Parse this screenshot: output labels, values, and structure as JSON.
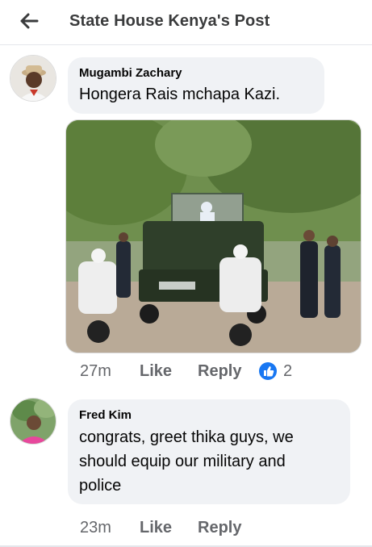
{
  "header": {
    "title": "State House Kenya's Post",
    "back_icon": "arrow-left-icon"
  },
  "comments": [
    {
      "author": "Mugambi Zachary",
      "text": "Hongera Rais mchapa Kazi.",
      "time": "27m",
      "like_label": "Like",
      "reply_label": "Reply",
      "reaction_icon": "like-reaction-icon",
      "reaction_count": "2"
    },
    {
      "author": "Fred Kim",
      "text_lines": [
        "congrats, greet thika guys,   we",
        "should equip our military and",
        "police"
      ],
      "time": "23m",
      "like_label": "Like",
      "reply_label": "Reply"
    }
  ],
  "colors": {
    "accent": "#1877f2",
    "bubble": "#f0f2f5",
    "meta_text": "#65676b"
  }
}
